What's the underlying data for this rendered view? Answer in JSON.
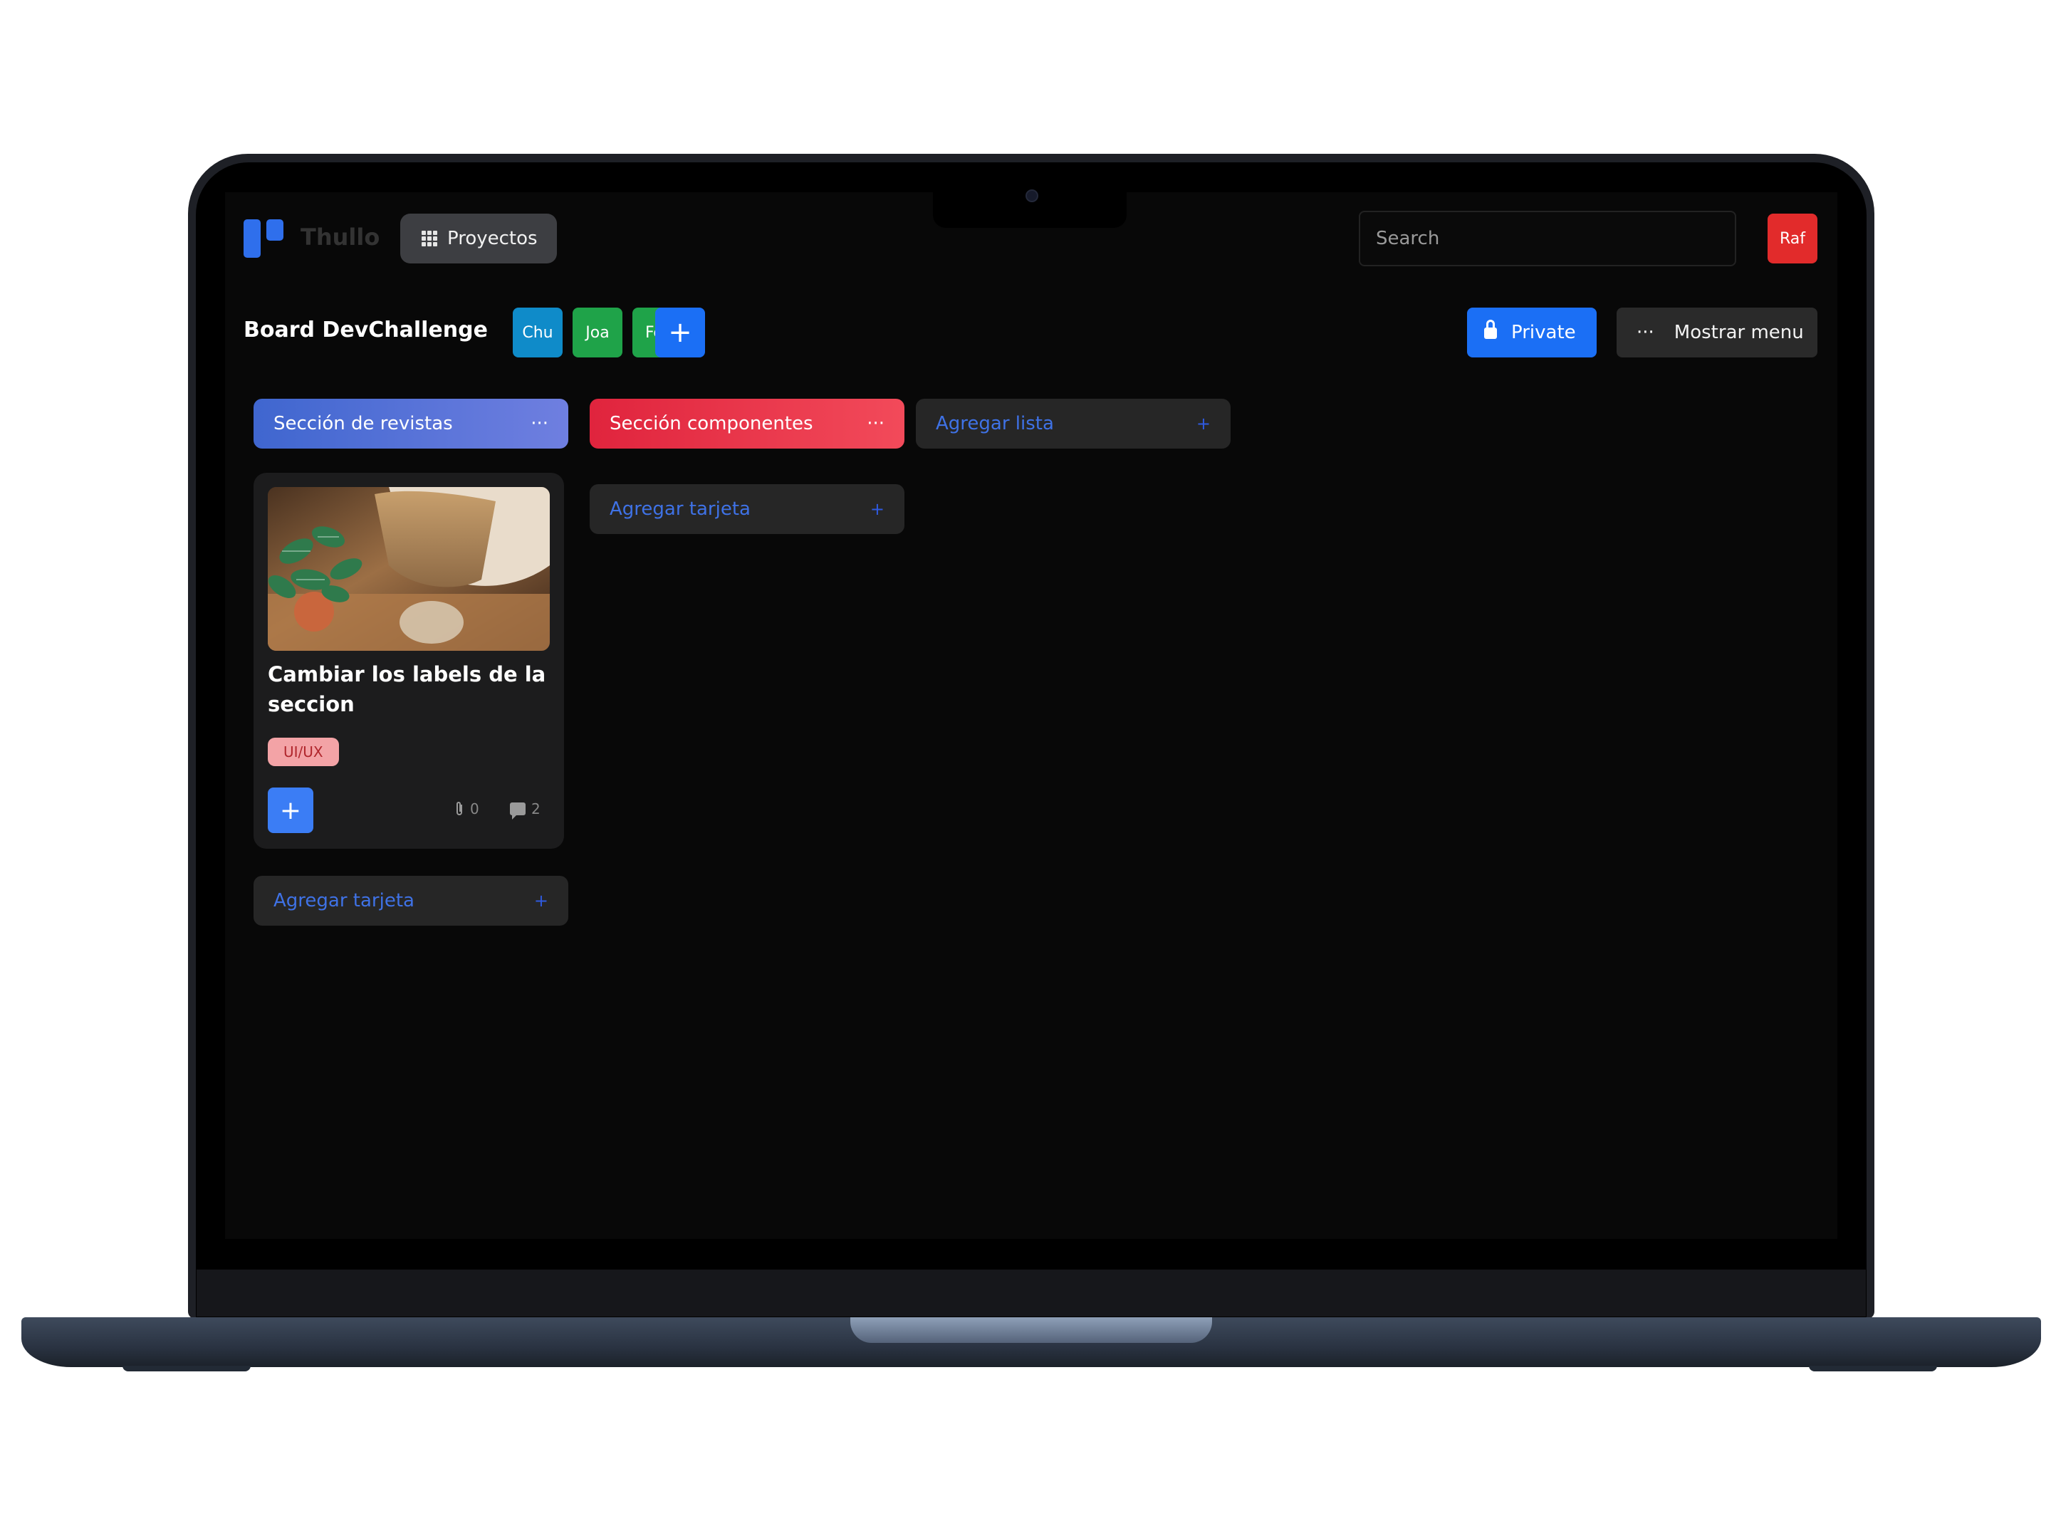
{
  "app": {
    "brand": "Thullo"
  },
  "header": {
    "projects_label": "Proyectos",
    "search_placeholder": "Search",
    "user_initials": "Raf"
  },
  "board": {
    "title": "Board DevChallenge",
    "members": [
      "Chu",
      "Joa",
      "Fer"
    ],
    "add_member_label": "+",
    "private_label": "Private",
    "menu_dots": "···",
    "menu_label": "Mostrar menu"
  },
  "lists": [
    {
      "title": "Sección de revistas",
      "dots": "···",
      "cards": [
        {
          "title": "Cambiar los labels de la seccion",
          "tag": "UI/UX",
          "add_label": "+",
          "attachments": "0",
          "comments": "2"
        }
      ],
      "add_card_label": "Agregar tarjeta"
    },
    {
      "title": "Sección componentes",
      "dots": "···",
      "cards": [],
      "add_card_label": "Agregar tarjeta"
    }
  ],
  "add_list_label": "Agregar lista",
  "plus_glyph": "+",
  "colors": {
    "accent_blue": "#1b6ff5",
    "member_chu": "#0f8bc9",
    "member_joa": "#1fa349",
    "member_fer": "#1fa349",
    "list1_gradient": [
      "#3f66cf",
      "#6f7fe0"
    ],
    "list2_gradient": [
      "#e0243d",
      "#f24a5a"
    ],
    "tag_bg": "#f3a3a6",
    "user_avatar": "#e22b2b"
  }
}
